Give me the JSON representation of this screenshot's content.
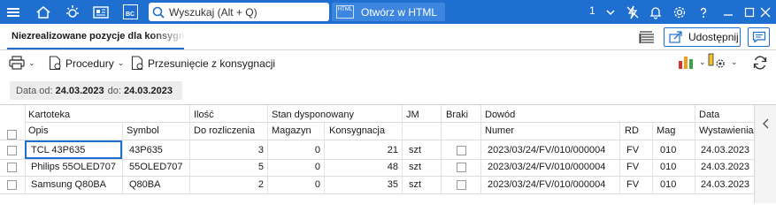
{
  "topbar": {
    "search_placeholder": "Wyszukaj (Alt + Q)",
    "html_badge": "HTML",
    "html_button_label": "Otwórz w HTML",
    "counter": "1",
    "bc_badge": "BC"
  },
  "tab": {
    "title": "Niezrealizowane pozycje dla konsygnacji",
    "share_label": "Udostępnij"
  },
  "toolbar": {
    "procedures_label": "Procedury",
    "shift_label": "Przesunięcie z konsygnacji"
  },
  "filter": {
    "label": "Data  od:",
    "from": "24.03.2023",
    "to_label": "do:",
    "to": "24.03.2023"
  },
  "grid": {
    "group_headers": {
      "kartoteka": "Kartoteka",
      "ilosc": "Ilość",
      "stan": "Stan dysponowany",
      "jm": "JM",
      "braki": "Braki",
      "dowod": "Dowód",
      "data": "Data"
    },
    "sub_headers": {
      "opis": "Opis",
      "symbol": "Symbol",
      "do_rozliczenia": "Do rozliczenia",
      "magazyn": "Magazyn",
      "konsygnacja": "Konsygnacja",
      "numer": "Numer",
      "rd": "RD",
      "mag": "Mag",
      "wystawienia": "Wystawienia"
    },
    "rows": [
      {
        "opis": "TCL 43P635",
        "symbol": "43P635",
        "do_rozliczenia": "3",
        "magazyn": "0",
        "konsygnacja": "21",
        "jm": "szt",
        "numer": "2023/03/24/FV/010/000004",
        "rd": "FV",
        "mag": "010",
        "wystawienia": "24.03.2023"
      },
      {
        "opis": "Philips 55OLED707",
        "symbol": "55OLED707",
        "do_rozliczenia": "5",
        "magazyn": "0",
        "konsygnacja": "48",
        "jm": "szt",
        "numer": "2023/03/24/FV/010/000004",
        "rd": "FV",
        "mag": "010",
        "wystawienia": "24.03.2023"
      },
      {
        "opis": "Samsung Q80BA",
        "symbol": "Q80BA",
        "do_rozliczenia": "2",
        "magazyn": "0",
        "konsygnacja": "35",
        "jm": "szt",
        "numer": "2023/03/24/FV/010/000004",
        "rd": "FV",
        "mag": "010",
        "wystawienia": "24.03.2023"
      }
    ]
  },
  "colors": {
    "accent": "#1f6fd1",
    "chart_icon_red": "#d9342b",
    "chart_icon_orange": "#f29c1f",
    "chart_icon_green": "#3aa04a"
  }
}
